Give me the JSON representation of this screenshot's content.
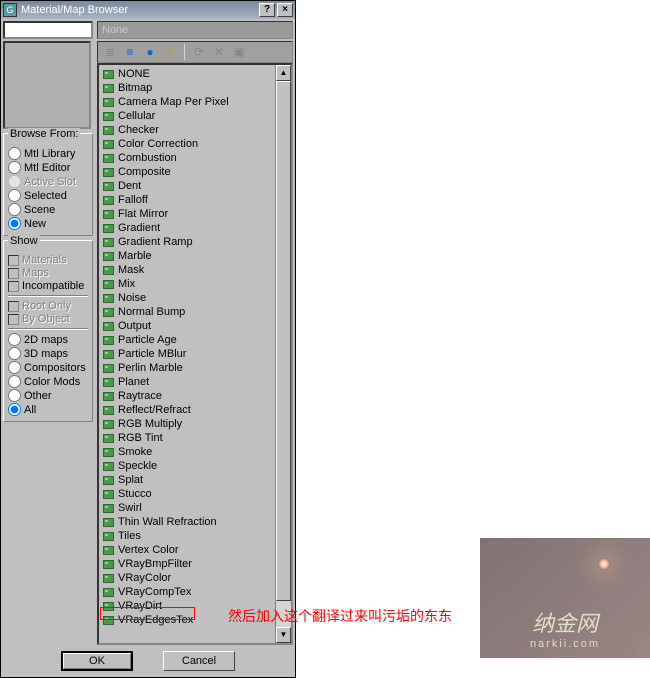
{
  "title": "Material/Map Browser",
  "name_display": "None",
  "browse_from": {
    "title": "Browse From:",
    "options": [
      {
        "label": "Mtl Library",
        "checked": false,
        "disabled": false
      },
      {
        "label": "Mtl Editor",
        "checked": false,
        "disabled": false
      },
      {
        "label": "Active Slot",
        "checked": false,
        "disabled": true
      },
      {
        "label": "Selected",
        "checked": false,
        "disabled": false
      },
      {
        "label": "Scene",
        "checked": false,
        "disabled": false
      },
      {
        "label": "New",
        "checked": true,
        "disabled": false
      }
    ]
  },
  "show": {
    "title": "Show",
    "checks": [
      {
        "label": "Materials",
        "disabled": true
      },
      {
        "label": "Maps",
        "disabled": true
      },
      {
        "label": "Incompatible",
        "disabled": false
      }
    ],
    "checks2": [
      {
        "label": "Root Only",
        "disabled": true
      },
      {
        "label": "By Object",
        "disabled": true
      }
    ],
    "radios": [
      {
        "label": "2D maps",
        "checked": false
      },
      {
        "label": "3D maps",
        "checked": false
      },
      {
        "label": "Compositors",
        "checked": false
      },
      {
        "label": "Color Mods",
        "checked": false
      },
      {
        "label": "Other",
        "checked": false
      },
      {
        "label": "All",
        "checked": true
      }
    ]
  },
  "list_items": [
    "NONE",
    "Bitmap",
    "Camera Map Per Pixel",
    "Cellular",
    "Checker",
    "Color Correction",
    "Combustion",
    "Composite",
    "Dent",
    "Falloff",
    "Flat Mirror",
    "Gradient",
    "Gradient Ramp",
    "Marble",
    "Mask",
    "Mix",
    "Noise",
    "Normal Bump",
    "Output",
    "Particle Age",
    "Particle MBlur",
    "Perlin Marble",
    "Planet",
    "Raytrace",
    "Reflect/Refract",
    "RGB Multiply",
    "RGB Tint",
    "Smoke",
    "Speckle",
    "Splat",
    "Stucco",
    "Swirl",
    "Thin Wall Refraction",
    "Tiles",
    "Vertex Color",
    "VRayBmpFilter",
    "VRayColor",
    "VRayCompTex",
    "VRayDirt",
    "VRayEdgesTex"
  ],
  "buttons": {
    "ok": "OK",
    "cancel": "Cancel"
  },
  "annotation": "然后加入这个翻译过来叫污垢的东东",
  "watermark": {
    "line1": "纳金网",
    "line2": "narkii.com"
  }
}
